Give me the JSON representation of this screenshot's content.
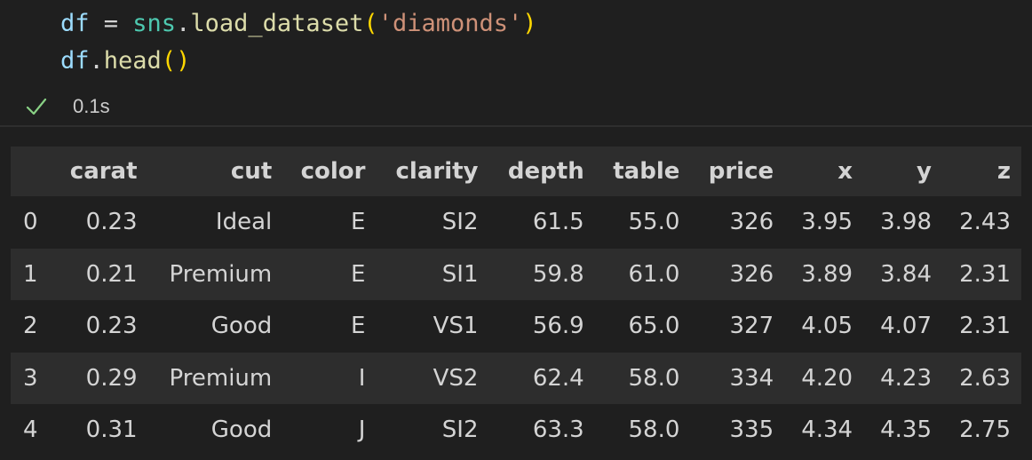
{
  "code": {
    "line1": {
      "var": "df",
      "assign": " = ",
      "module": "sns",
      "dot": ".",
      "func": "load_dataset",
      "open": "(",
      "arg": "'diamonds'",
      "close": ")"
    },
    "line2": {
      "var": "df",
      "dot": ".",
      "func": "head",
      "parens": "()"
    }
  },
  "status": {
    "icon": "check-icon",
    "time": "0.1s",
    "color": "#89d185"
  },
  "table": {
    "columns": [
      "",
      "carat",
      "cut",
      "color",
      "clarity",
      "depth",
      "table",
      "price",
      "x",
      "y",
      "z"
    ],
    "rows": [
      [
        "0",
        "0.23",
        "Ideal",
        "E",
        "SI2",
        "61.5",
        "55.0",
        "326",
        "3.95",
        "3.98",
        "2.43"
      ],
      [
        "1",
        "0.21",
        "Premium",
        "E",
        "SI1",
        "59.8",
        "61.0",
        "326",
        "3.89",
        "3.84",
        "2.31"
      ],
      [
        "2",
        "0.23",
        "Good",
        "E",
        "VS1",
        "56.9",
        "65.0",
        "327",
        "4.05",
        "4.07",
        "2.31"
      ],
      [
        "3",
        "0.29",
        "Premium",
        "I",
        "VS2",
        "62.4",
        "58.0",
        "334",
        "4.20",
        "4.23",
        "2.63"
      ],
      [
        "4",
        "0.31",
        "Good",
        "J",
        "SI2",
        "63.3",
        "58.0",
        "335",
        "4.34",
        "4.35",
        "2.75"
      ]
    ]
  }
}
